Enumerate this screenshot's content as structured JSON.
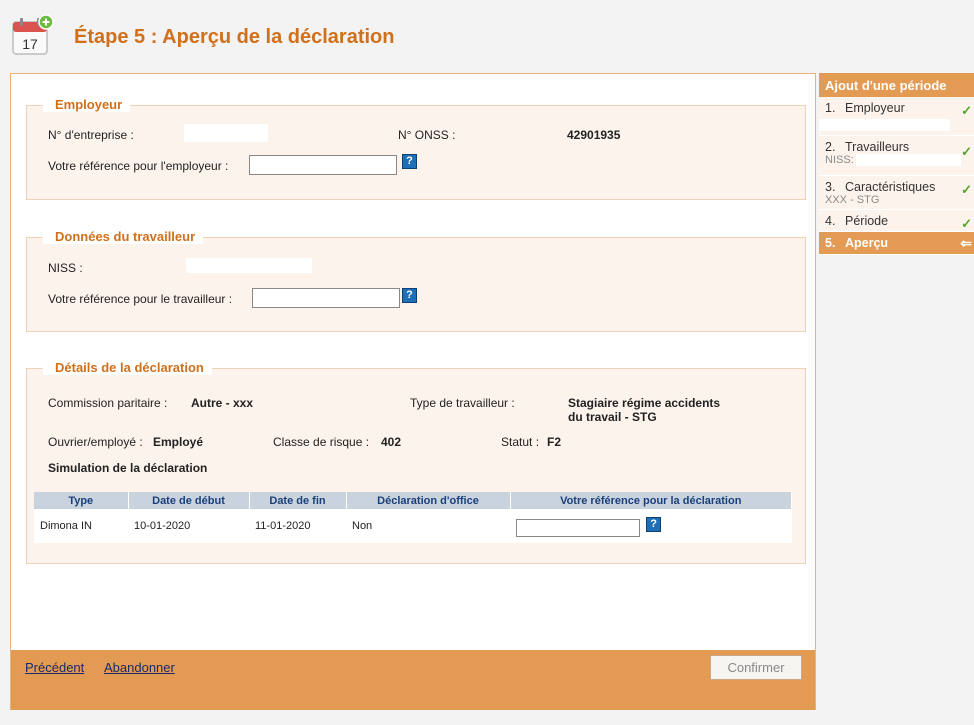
{
  "header": {
    "icon_day": "17",
    "title": "Étape 5 : Aperçu de la déclaration"
  },
  "employeur": {
    "legend": "Employeur",
    "entreprise_label": "N° d'entreprise :",
    "onss_label": "N° ONSS :",
    "onss_value": "42901935",
    "reference_label": "Votre référence pour l'employeur :",
    "reference_value": ""
  },
  "travailleur": {
    "legend": "Données du travailleur",
    "niss_label": "NISS :",
    "reference_label": "Votre référence pour le travailleur :",
    "reference_value": ""
  },
  "details": {
    "legend": "Détails de la déclaration",
    "commission_label": "Commission paritaire :",
    "commission_value": "Autre - xxx",
    "type_travailleur_label": "Type de travailleur :",
    "type_travailleur_value_line1": "Stagiaire régime accidents",
    "type_travailleur_value_line2": "du travail - STG",
    "ouvrier_label": "Ouvrier/employé :",
    "ouvrier_value": "Employé",
    "classe_label": "Classe de risque :",
    "classe_value": "402",
    "statut_label": "Statut :",
    "statut_value": "F2",
    "simulation_label": "Simulation de la déclaration",
    "table": {
      "headers": [
        "Type",
        "Date de début",
        "Date de fin",
        "Déclaration d'office",
        "Votre référence pour la déclaration"
      ],
      "rows": [
        [
          "Dimona IN",
          "10-01-2020",
          "11-01-2020",
          "Non",
          ""
        ]
      ]
    }
  },
  "footer": {
    "previous_label": "Précédent",
    "abandon_label": "Abandonner",
    "confirm_label": "Confirmer"
  },
  "help_glyph": "?",
  "sidebar": {
    "title": "Ajout d'une période",
    "steps": [
      {
        "num": "1.",
        "label": "Employeur",
        "sub": "",
        "status": "done"
      },
      {
        "num": "2.",
        "label": "Travailleurs",
        "sub": "NISS:",
        "status": "done"
      },
      {
        "num": "3.",
        "label": "Caractéristiques",
        "sub": "XXX - STG",
        "status": "done"
      },
      {
        "num": "4.",
        "label": "Période",
        "sub": "",
        "status": "done"
      },
      {
        "num": "5.",
        "label": "Aperçu",
        "sub": "",
        "status": "current"
      }
    ],
    "check_glyph": "✓",
    "arrow_glyph": "⇐"
  },
  "colors": {
    "accent_orange": "#e39a52",
    "title_orange": "#d0701b",
    "section_bg": "#fcf4ec",
    "help_blue": "#1e6fb5",
    "check_green": "#55a32c",
    "table_header_bg": "#c8d3de"
  }
}
